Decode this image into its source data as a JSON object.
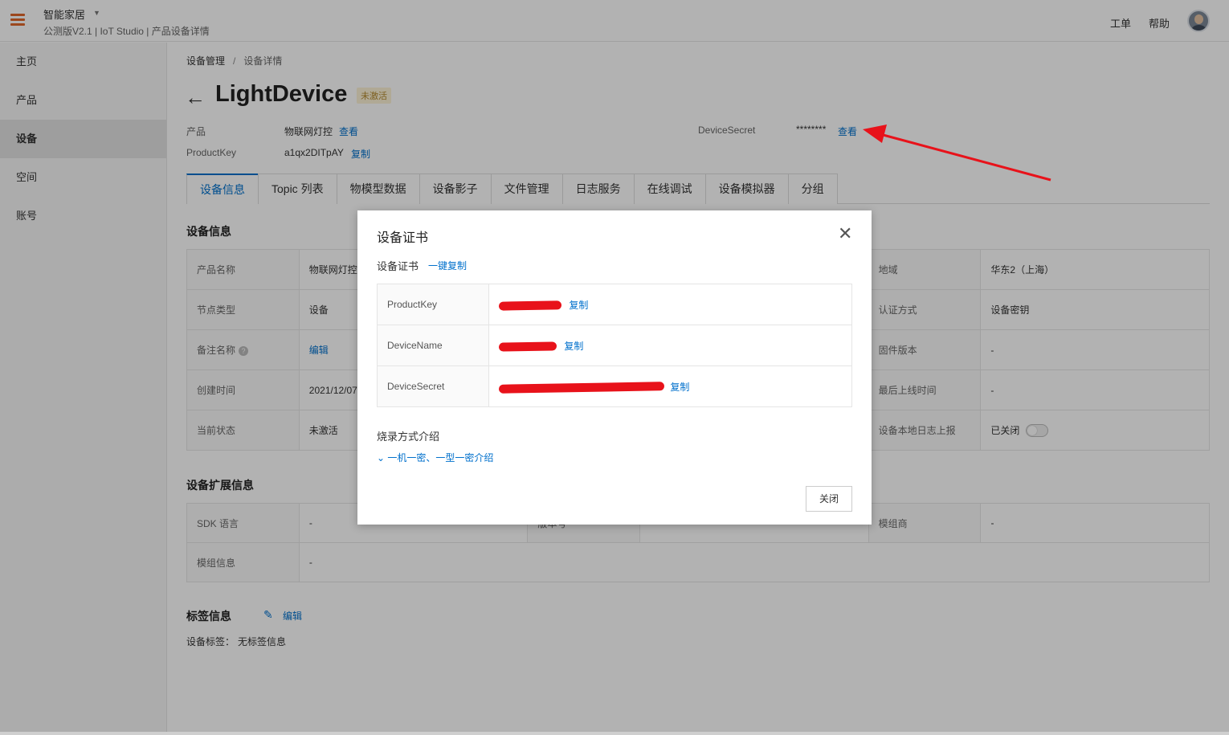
{
  "header": {
    "app_name": "智能家居",
    "subtitle": "公测版V2.1 | IoT Studio | 产品设备详情",
    "links": [
      "工单",
      "帮助"
    ]
  },
  "sidebar": {
    "items": [
      {
        "label": "主页"
      },
      {
        "label": "产品"
      },
      {
        "label": "设备",
        "active": true
      },
      {
        "label": "空间"
      },
      {
        "label": "账号"
      }
    ]
  },
  "breadcrumb": {
    "parent": "设备管理",
    "sep": "/",
    "current": "设备详情"
  },
  "device": {
    "title": "LightDevice",
    "status_badge": "未激活",
    "product_label": "产品",
    "product_value": "物联网灯控",
    "product_link": "查看",
    "productkey_label": "ProductKey",
    "productkey_value": "a1qx2DITpAY",
    "productkey_copy": "复制",
    "secret_label": "DeviceSecret",
    "secret_value": "********",
    "secret_link": "查看"
  },
  "tabs": [
    "设备信息",
    "Topic 列表",
    "物模型数据",
    "设备影子",
    "文件管理",
    "日志服务",
    "在线调试",
    "设备模拟器",
    "分组"
  ],
  "device_info": {
    "title": "设备信息",
    "rows": [
      {
        "k1": "产品名称",
        "v1": "物联网灯控",
        "k3": "地域",
        "v3": "华东2（上海）"
      },
      {
        "k1": "节点类型",
        "v1": "设备",
        "k3": "认证方式",
        "v3": "设备密钥"
      },
      {
        "k1": "备注名称",
        "v1": "编辑",
        "k3": "固件版本",
        "v3": "-"
      },
      {
        "k1": "创建时间",
        "v1": "2021/12/07",
        "k3": "最后上线时间",
        "v3": "-"
      },
      {
        "k1": "当前状态",
        "v1": "未激活",
        "k3": "设备本地日志上报",
        "v3": "已关闭"
      }
    ]
  },
  "ext_info": {
    "title": "设备扩展信息",
    "row1": {
      "k1": "SDK 语言",
      "v1": "-",
      "k2": "版本号",
      "k3": "模组商",
      "v3": "-"
    },
    "row2": {
      "k1": "模组信息",
      "v1": "-"
    }
  },
  "tags": {
    "title": "标签信息",
    "edit": "编辑",
    "label": "设备标签：",
    "value": "无标签信息"
  },
  "modal": {
    "title": "设备证书",
    "cert_label": "设备证书",
    "copy_all": "一键复制",
    "rows": [
      {
        "key": "ProductKey",
        "copy": "复制"
      },
      {
        "key": "DeviceName",
        "copy": "复制"
      },
      {
        "key": "DeviceSecret",
        "copy": "复制"
      }
    ],
    "burn_title": "烧录方式介绍",
    "burn_link": "一机一密、一型一密介绍",
    "close_button": "关闭"
  },
  "colors": {
    "accent": "#0070cc",
    "brand_menu": "#e0662a",
    "annotation": "#e8121a"
  }
}
